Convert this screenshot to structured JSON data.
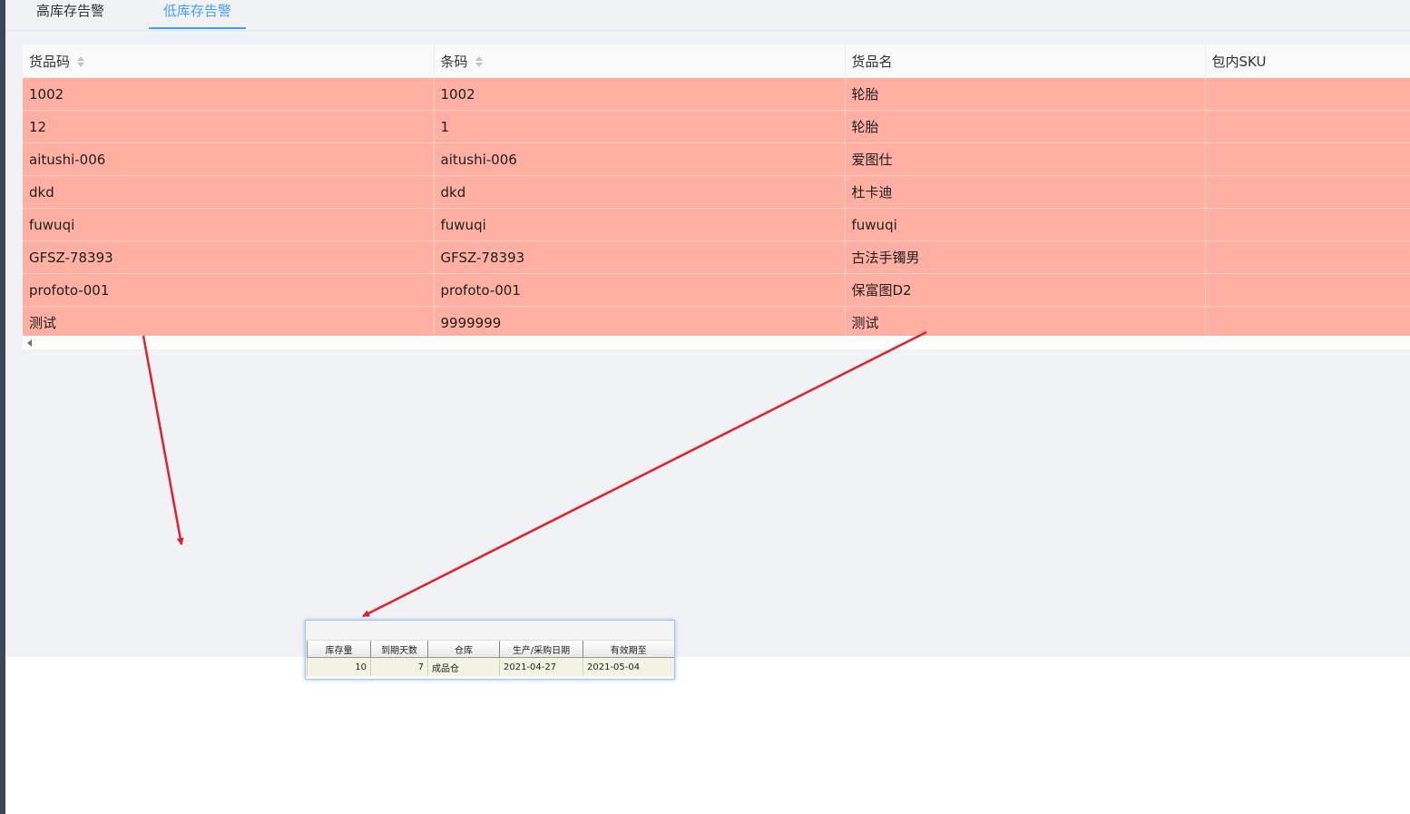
{
  "tabs": [
    {
      "label": "高库存告警",
      "active": false
    },
    {
      "label": "低库存告警",
      "active": true
    }
  ],
  "table": {
    "columns": [
      "货品码",
      "条码",
      "货品名",
      "包内SKU"
    ],
    "rows": [
      [
        "1002",
        "1002",
        "轮胎",
        ""
      ],
      [
        "12",
        "1",
        "轮胎",
        ""
      ],
      [
        "aitushi-006",
        "aitushi-006",
        "爱图仕",
        ""
      ],
      [
        "dkd",
        "dkd",
        "杜卡迪",
        ""
      ],
      [
        "fuwuqi",
        "fuwuqi",
        "fuwuqi",
        ""
      ],
      [
        "GFSZ-78393",
        "GFSZ-78393",
        "古法手镯男",
        ""
      ],
      [
        "profoto-001",
        "profoto-001",
        "保富图D2",
        ""
      ],
      [
        "测试",
        "9999999",
        "测试",
        ""
      ]
    ],
    "row_color": "#ffb0a3"
  },
  "popup": {
    "columns": [
      "库存量",
      "到期天数",
      "仓库",
      "生产/采购日期",
      "有效期至"
    ],
    "row": [
      "10",
      "7",
      "成品仓",
      "2021-04-27",
      "2021-05-04"
    ]
  },
  "colors": {
    "accent": "#409eff",
    "arrow": "#e0202a",
    "sidebar": "#3b4756"
  }
}
